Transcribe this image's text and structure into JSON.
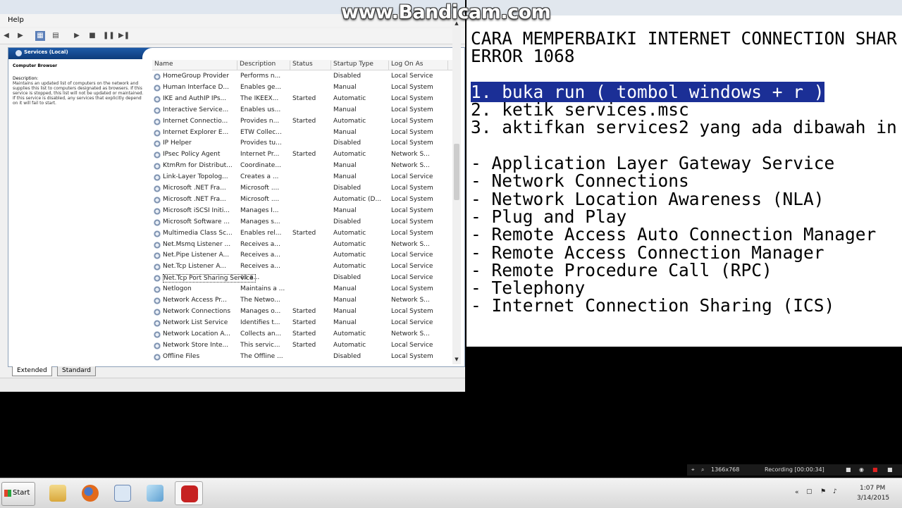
{
  "watermark": "www.Bandicam.com",
  "services_window": {
    "menu": [
      "Help"
    ],
    "header_label": "Services (Local)",
    "description_panel": {
      "title": "Computer Browser",
      "label": "Description:",
      "text": "Maintains an updated list of computers on the network and supplies this list to computers designated as browsers. If this service is stopped, this list will not be updated or maintained. If this service is disabled, any services that explicitly depend on it will fail to start."
    },
    "columns": [
      "Name",
      "Description",
      "Status",
      "Startup Type",
      "Log On As"
    ],
    "rows": [
      {
        "name": "HomeGroup Provider",
        "desc": "Performs n...",
        "status": "",
        "startup": "Disabled",
        "logon": "Local Service"
      },
      {
        "name": "Human Interface D...",
        "desc": "Enables ge...",
        "status": "",
        "startup": "Manual",
        "logon": "Local System"
      },
      {
        "name": "IKE and AuthIP IPs...",
        "desc": "The IKEEX...",
        "status": "Started",
        "startup": "Automatic",
        "logon": "Local System"
      },
      {
        "name": "Interactive Service...",
        "desc": "Enables us...",
        "status": "",
        "startup": "Manual",
        "logon": "Local System"
      },
      {
        "name": "Internet Connectio...",
        "desc": "Provides n...",
        "status": "Started",
        "startup": "Automatic",
        "logon": "Local System"
      },
      {
        "name": "Internet Explorer E...",
        "desc": "ETW Collec...",
        "status": "",
        "startup": "Manual",
        "logon": "Local System"
      },
      {
        "name": "IP Helper",
        "desc": "Provides tu...",
        "status": "",
        "startup": "Disabled",
        "logon": "Local System"
      },
      {
        "name": "IPsec Policy Agent",
        "desc": "Internet Pr...",
        "status": "Started",
        "startup": "Automatic",
        "logon": "Network S..."
      },
      {
        "name": "KtmRm for Distribut...",
        "desc": "Coordinate...",
        "status": "",
        "startup": "Manual",
        "logon": "Network S..."
      },
      {
        "name": "Link-Layer Topolog...",
        "desc": "Creates a ...",
        "status": "",
        "startup": "Manual",
        "logon": "Local Service"
      },
      {
        "name": "Microsoft .NET Fra...",
        "desc": "Microsoft ....",
        "status": "",
        "startup": "Disabled",
        "logon": "Local System"
      },
      {
        "name": "Microsoft .NET Fra...",
        "desc": "Microsoft ....",
        "status": "",
        "startup": "Automatic (D...",
        "logon": "Local System"
      },
      {
        "name": "Microsoft iSCSI Initi...",
        "desc": "Manages I...",
        "status": "",
        "startup": "Manual",
        "logon": "Local System"
      },
      {
        "name": "Microsoft Software ...",
        "desc": "Manages s...",
        "status": "",
        "startup": "Disabled",
        "logon": "Local System"
      },
      {
        "name": "Multimedia Class Sc...",
        "desc": "Enables rel...",
        "status": "Started",
        "startup": "Automatic",
        "logon": "Local System"
      },
      {
        "name": "Net.Msmq Listener ...",
        "desc": "Receives a...",
        "status": "",
        "startup": "Automatic",
        "logon": "Network S..."
      },
      {
        "name": "Net.Pipe Listener A...",
        "desc": "Receives a...",
        "status": "",
        "startup": "Automatic",
        "logon": "Local Service"
      },
      {
        "name": "Net.Tcp Listener A...",
        "desc": "Receives a...",
        "status": "",
        "startup": "Automatic",
        "logon": "Local Service"
      },
      {
        "name": "Net.Tcp Port Sharing Service",
        "desc": "es a...",
        "status": "",
        "startup": "Disabled",
        "logon": "Local Service"
      },
      {
        "name": "Netlogon",
        "desc": "Maintains a ...",
        "status": "",
        "startup": "Manual",
        "logon": "Local System"
      },
      {
        "name": "Network Access Pr...",
        "desc": "The Netwo...",
        "status": "",
        "startup": "Manual",
        "logon": "Network S..."
      },
      {
        "name": "Network Connections",
        "desc": "Manages o...",
        "status": "Started",
        "startup": "Manual",
        "logon": "Local System"
      },
      {
        "name": "Network List Service",
        "desc": "Identifies t...",
        "status": "Started",
        "startup": "Manual",
        "logon": "Local Service"
      },
      {
        "name": "Network Location A...",
        "desc": "Collects an...",
        "status": "Started",
        "startup": "Automatic",
        "logon": "Network S..."
      },
      {
        "name": "Network Store Inte...",
        "desc": "This servic...",
        "status": "Started",
        "startup": "Automatic",
        "logon": "Local Service"
      },
      {
        "name": "Offline Files",
        "desc": "The Offline ...",
        "status": "",
        "startup": "Disabled",
        "logon": "Local System"
      }
    ],
    "selected_row_index": 18,
    "tabs": [
      "Extended",
      "Standard"
    ]
  },
  "notepad": {
    "lines": [
      "CARA MEMPERBAIKI INTERNET CONNECTION SHAR",
      "ERROR 1068",
      "",
      "1. buka run ( tombol windows + r )",
      "2. ketik services.msc",
      "3. aktifkan services2 yang ada dibawah in",
      "",
      "- Application Layer Gateway Service",
      "- Network Connections",
      "- Network Location Awareness (NLA)",
      "- Plug and Play",
      "- Remote Access Auto Connection Manager",
      "- Remote Access Connection Manager",
      "- Remote Procedure Call (RPC)",
      "- Telephony",
      "- Internet Connection Sharing (ICS)"
    ],
    "highlighted_line_index": 3
  },
  "recorder": {
    "resolution": "1366x768",
    "status": "Recording [00:00:34]",
    "record_color": "#e02020"
  },
  "taskbar": {
    "start_label": "Start",
    "apps": [
      "explorer-icon",
      "firefox-icon",
      "server-manager-icon",
      "powershell-icon",
      "bandicam-icon"
    ],
    "time": "1:07 PM",
    "date": "3/14/2015"
  }
}
